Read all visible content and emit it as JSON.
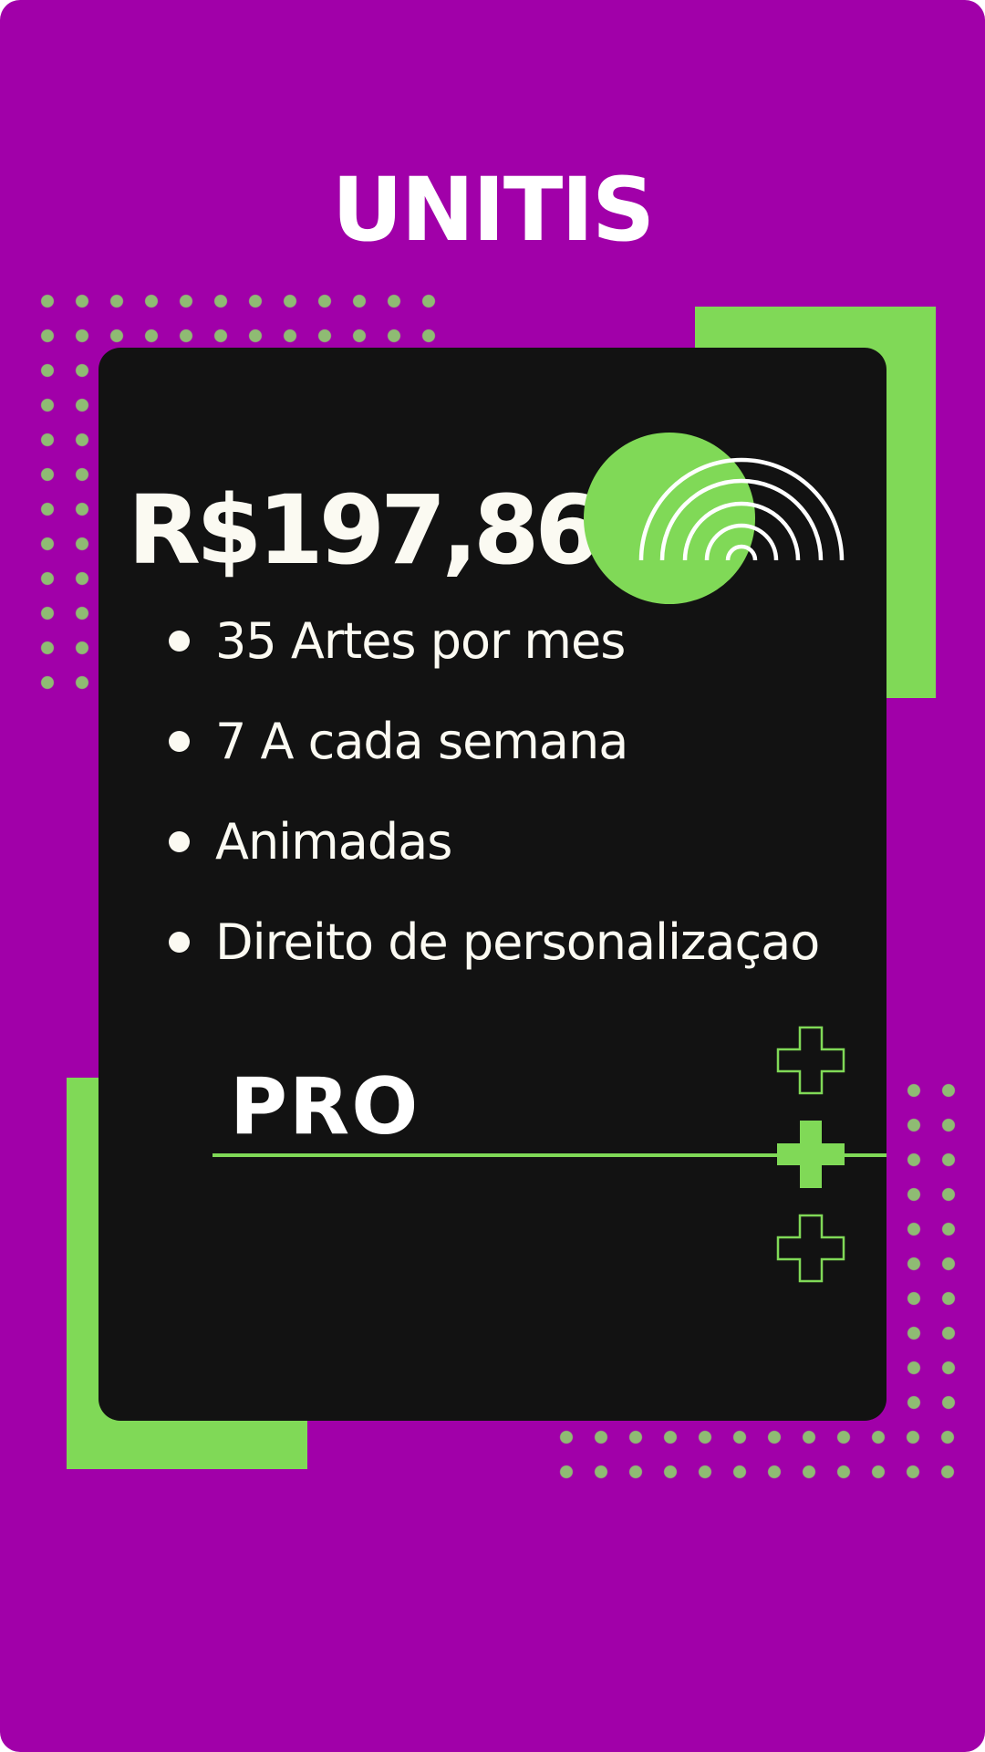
{
  "header": {
    "brand": "UNITIS"
  },
  "card": {
    "price": "R$197,86",
    "features": [
      "35  Artes por mes",
      "7 A cada semana",
      "Animadas",
      "Direito de personalizaçao"
    ],
    "plan": "PRO"
  },
  "colors": {
    "background": "#a100a9",
    "accent": "#80d957",
    "card": "#121212",
    "text": "#fbfaf2",
    "dots": "#8fbb73"
  },
  "icons": [
    "signal-arcs-icon",
    "plus-outline-icon",
    "plus-filled-icon"
  ]
}
